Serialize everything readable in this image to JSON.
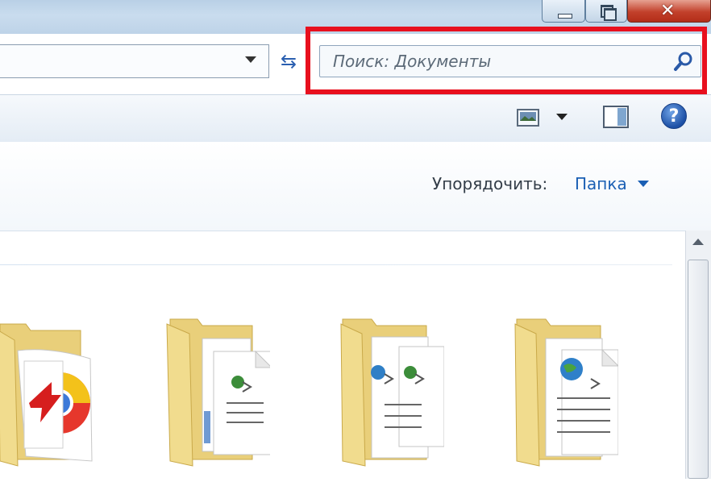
{
  "window": {
    "controls": {
      "minimize": "minimize-icon",
      "maximize": "restore-icon",
      "close": "close-icon"
    }
  },
  "address_bar": {
    "dropdown_icon": "chevron-down-icon",
    "refresh_icon": "refresh-icon"
  },
  "search": {
    "placeholder": "Поиск: Документы",
    "icon": "search-icon",
    "highlight_color": "#e8101e"
  },
  "toolbar": {
    "views_icon": "views-icon",
    "preview_pane_icon": "preview-pane-icon",
    "help_icon": "help-icon",
    "help_glyph": "?"
  },
  "library": {
    "arrange_label": "Упорядочить:",
    "arrange_value": "Папка"
  },
  "folders": [
    {
      "name": "",
      "icon": "folder-with-flash-chrome-icon"
    },
    {
      "name": "",
      "icon": "folder-with-documents-icon"
    },
    {
      "name": "",
      "icon": "folder-with-web-documents-icon"
    },
    {
      "name": "",
      "icon": "folder-with-globe-document-icon"
    }
  ],
  "colors": {
    "accent": "#1a5fb4",
    "title_bar": "#c9dcee",
    "close_button": "#c2402b"
  }
}
